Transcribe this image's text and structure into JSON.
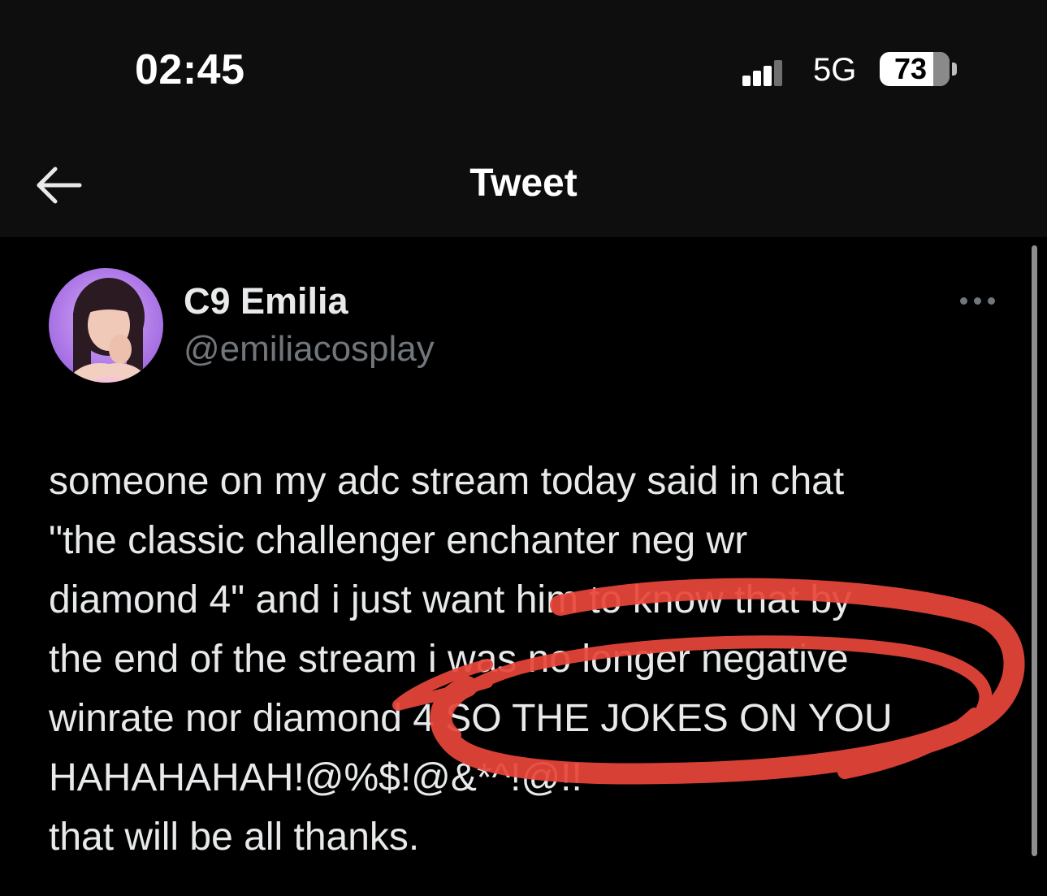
{
  "status_bar": {
    "time": "02:45",
    "network": "5G",
    "battery": "73"
  },
  "nav": {
    "back_icon": "arrow-left-icon",
    "title": "Tweet"
  },
  "tweet": {
    "author": {
      "name": "C9 Emilia",
      "handle": "@emiliacosplay"
    },
    "more_icon": "more-horizontal-icon",
    "lines": [
      "someone on my adc stream today said in chat",
      "\"the classic challenger enchanter neg wr",
      "diamond 4\" and i just want him to know that by",
      "the end of the stream i was no longer negative",
      "winrate nor diamond 4 SO THE JOKES ON YOU",
      "HAHAHAHAH!@%$!@&*^!@!!",
      "that will be all thanks."
    ]
  },
  "annotation": {
    "color": "#e8463a"
  }
}
